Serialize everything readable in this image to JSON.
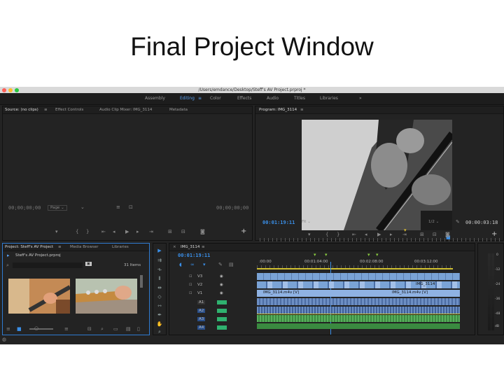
{
  "slide": {
    "title": "Final Project Window"
  },
  "window": {
    "path": "/Users/emdance/Desktop/Steff's AV Project.prproj *"
  },
  "workspaces": [
    "Assembly",
    "Editing",
    "Color",
    "Effects",
    "Audio",
    "Titles",
    "Libraries"
  ],
  "workspace_overflow": "»",
  "source_panel": {
    "tabs": [
      "Source: (no clips)",
      "Effect Controls",
      "Audio Clip Mixer: IMG_3114",
      "Metadata"
    ],
    "timecode_left": "00;00;00;00",
    "page_label": "Page",
    "timecode_right": "00;00;00;00"
  },
  "program_panel": {
    "tab": "Program: IMG_3114",
    "timecode": "00:01:19:11",
    "fit": "Fit",
    "quality": "1/2",
    "duration": "00:00:03:18"
  },
  "project_panel": {
    "tabs": [
      "Project: Steff's AV Project",
      "Media Browser",
      "Libraries"
    ],
    "file": "Steff's AV Project.prproj",
    "items_count": "31 Items"
  },
  "timeline": {
    "sequence": "IMG_3114",
    "timecode": "00:01:19:11",
    "ruler_labels": [
      ":00:00",
      "00:01:04:00",
      "00:02:08:00",
      "00:03:12:00"
    ],
    "video_tracks": [
      "V3",
      "V2",
      "V1"
    ],
    "audio_tracks": [
      "A1",
      "A2",
      "A3",
      "A4"
    ],
    "clip_names": [
      "IMG_3114",
      "IMG_3114.m4v [V]",
      "IMG_3114.m4v [V]"
    ]
  },
  "meter": {
    "scale": [
      "0",
      "-12",
      "-24",
      "-36",
      "-48",
      "dB"
    ]
  }
}
